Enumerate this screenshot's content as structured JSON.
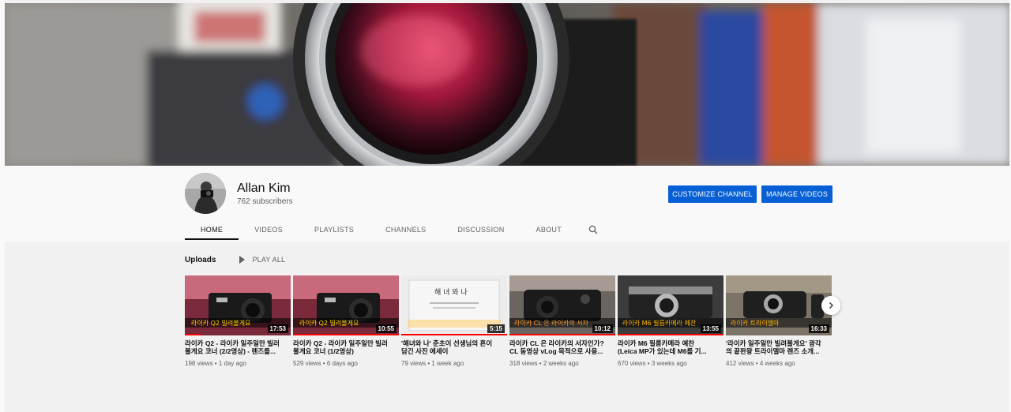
{
  "channel": {
    "name": "Allan Kim",
    "subscribers": "762 subscribers"
  },
  "buttons": {
    "customize": "CUSTOMIZE CHANNEL",
    "manage": "MANAGE VIDEOS"
  },
  "tabs": [
    {
      "label": "HOME",
      "active": true
    },
    {
      "label": "VIDEOS"
    },
    {
      "label": "PLAYLISTS"
    },
    {
      "label": "CHANNELS"
    },
    {
      "label": "DISCUSSION"
    },
    {
      "label": "ABOUT"
    }
  ],
  "section": {
    "title": "Uploads",
    "play_all": "PLAY ALL"
  },
  "videos": [
    {
      "duration": "17:53",
      "thumb_text": "라이카 Q2 빌려볼게요",
      "title_line1": "라이카 Q2 - 라이카 일주일만 빌러",
      "title_line2": "볼게요 코너 (2/2영상) - 렌즈를...",
      "meta": "198 views • 1 day ago"
    },
    {
      "duration": "10:55",
      "thumb_text": "라이카 Q2 빌려볼게요",
      "title_line1": "라이카 Q2 - 라이카 일주일만 빌러",
      "title_line2": "볼게요 코너 (1/2영상)",
      "meta": "529 views • 6 days ago"
    },
    {
      "duration": "5:15",
      "thumb_text": "해 녀 와   나",
      "title_line1": "'해녀와 나' 준초이 선생님의 혼이",
      "title_line2": "담긴 사진 에세이",
      "meta": "79 views • 1 week ago"
    },
    {
      "duration": "10:12",
      "thumb_text": "라이카 CL 은 라이카의 서자",
      "title_line1": "라이카 CL 은 라이카의 서자인가?",
      "title_line2": "CL 동영상 vLog 목적으로 사용...",
      "meta": "318 views • 2 weeks ago"
    },
    {
      "duration": "13:55",
      "thumb_text": "라이카 M6 필름카메라 예찬",
      "title_line1": "라이카 M6 필름카메라 예찬",
      "title_line2": "(Leica MP가 있는데 M6를 기...",
      "meta": "670 views • 3 weeks ago"
    },
    {
      "duration": "16:33",
      "thumb_text": "라이카 트라이엘마",
      "title_line1": "'라이카 일주일만 빌려볼게요' 광각",
      "title_line2": "의 끝판왕 트라이엘마 렌즈 소개...",
      "meta": "412 views • 4 weeks ago"
    }
  ],
  "icons": {
    "search": "search-icon",
    "play": "play-icon",
    "next": "chevron-right-icon"
  },
  "colors": {
    "primary_button": "#065fd4",
    "progress": "#ff0000"
  }
}
